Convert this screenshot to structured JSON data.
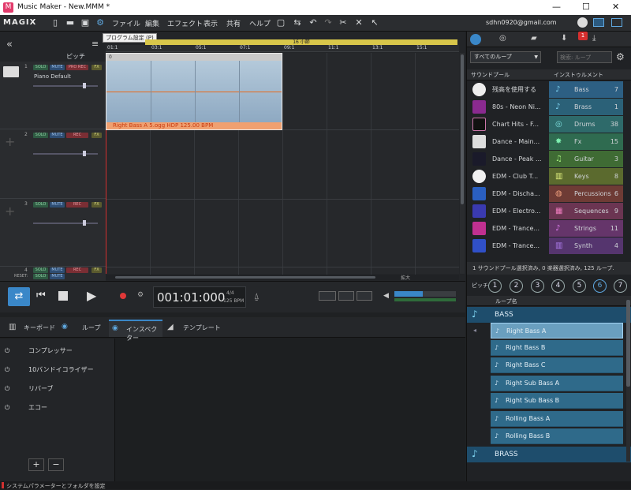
{
  "window": {
    "title": "Music Maker - New.MMM *",
    "min": "—",
    "max": "☐",
    "close": "✕"
  },
  "menu": {
    "logo": "MAGIX",
    "items": [
      "ファイル",
      "編集",
      "エフェクト",
      "表示",
      "共有",
      "ヘルプ"
    ],
    "account": "sdhn0920@gmail.com"
  },
  "tooltip": "プログラム設定 (P)",
  "timeline": {
    "bar_label": "16 小節",
    "markers": [
      "01:1",
      "03:1",
      "05:1",
      "07:1",
      "09:1",
      "11:1",
      "13:1",
      "15:1"
    ],
    "pitch_label": "ピッチ"
  },
  "tracks": [
    {
      "number": "1",
      "name": "Piano Default",
      "solo": "SOLO",
      "mute": "MUTE",
      "rec": "PRO REC",
      "fx": "FX"
    },
    {
      "number": "2",
      "name": "",
      "solo": "SOLO",
      "mute": "MUTE",
      "rec": "REC",
      "fx": "FX"
    },
    {
      "number": "3",
      "name": "",
      "solo": "SOLO",
      "mute": "MUTE",
      "rec": "REC",
      "fx": "FX"
    },
    {
      "number": "4",
      "name": "",
      "solo": "SOLO",
      "mute": "MUTE",
      "rec": "REC",
      "fx": "FX"
    }
  ],
  "reset_label": "RESET:",
  "clip": {
    "label": "Right Bass A 5.ogg HDP   125.00 BPM",
    "header": "0"
  },
  "zoom_label": "拡大",
  "transport": {
    "time": "001:01:000",
    "bpm": "125 BPM",
    "signature": "4/4"
  },
  "lower_tabs": [
    "キーボード",
    "ループ",
    "インスペクター",
    "テンプレート"
  ],
  "effects": [
    "コンプレッサー",
    "10バンドイコライザー",
    "リバーブ",
    "エコー"
  ],
  "add_btn": "+",
  "remove_btn": "−",
  "right": {
    "filter_select": "すべてのループ",
    "search_placeholder": "検索: ループ",
    "soundpool_header": "サウンドプール",
    "instruments_header": "インストゥルメント",
    "pools": [
      "残高を使用する",
      "80s - Neon Ni...",
      "Chart Hits - F...",
      "Dance - Main...",
      "Dance - Peak ...",
      "EDM - Club T...",
      "EDM - Discha...",
      "EDM - Electro...",
      "EDM - Trance...",
      "EDM - Trance..."
    ],
    "categories": [
      {
        "name": "Bass",
        "count": "7",
        "color": "#2d5f83"
      },
      {
        "name": "Brass",
        "count": "1",
        "color": "#2b6178"
      },
      {
        "name": "Drums",
        "count": "38",
        "color": "#2e6a6a"
      },
      {
        "name": "Fx",
        "count": "15",
        "color": "#2f6b50"
      },
      {
        "name": "Guitar",
        "count": "3",
        "color": "#3f6b34"
      },
      {
        "name": "Keys",
        "count": "8",
        "color": "#5b6a2e"
      },
      {
        "name": "Percussions",
        "count": "6",
        "color": "#6e3b35"
      },
      {
        "name": "Sequences",
        "count": "9",
        "color": "#6b3552"
      },
      {
        "name": "Strings",
        "count": "11",
        "color": "#65356a"
      },
      {
        "name": "Synth",
        "count": "4",
        "color": "#55356e"
      }
    ],
    "status": "1 サウンドプール選択済み, 0 楽器選択済み, 125 ループ.",
    "pitch_label": "ピッチ",
    "pitch_numbers": [
      "1",
      "2",
      "3",
      "4",
      "5",
      "6",
      "7"
    ],
    "loop_name_header": "ループ名",
    "group_bass": "BASS",
    "group_brass": "BRASS",
    "loops": [
      "Right Bass A",
      "Right Bass B",
      "Right Bass C",
      "Right Sub Bass A",
      "Right Sub Bass B",
      "Rolling Bass A",
      "Rolling Bass B"
    ],
    "badge": "1"
  },
  "status_text": "システムパラメーターとフォルダを設定"
}
